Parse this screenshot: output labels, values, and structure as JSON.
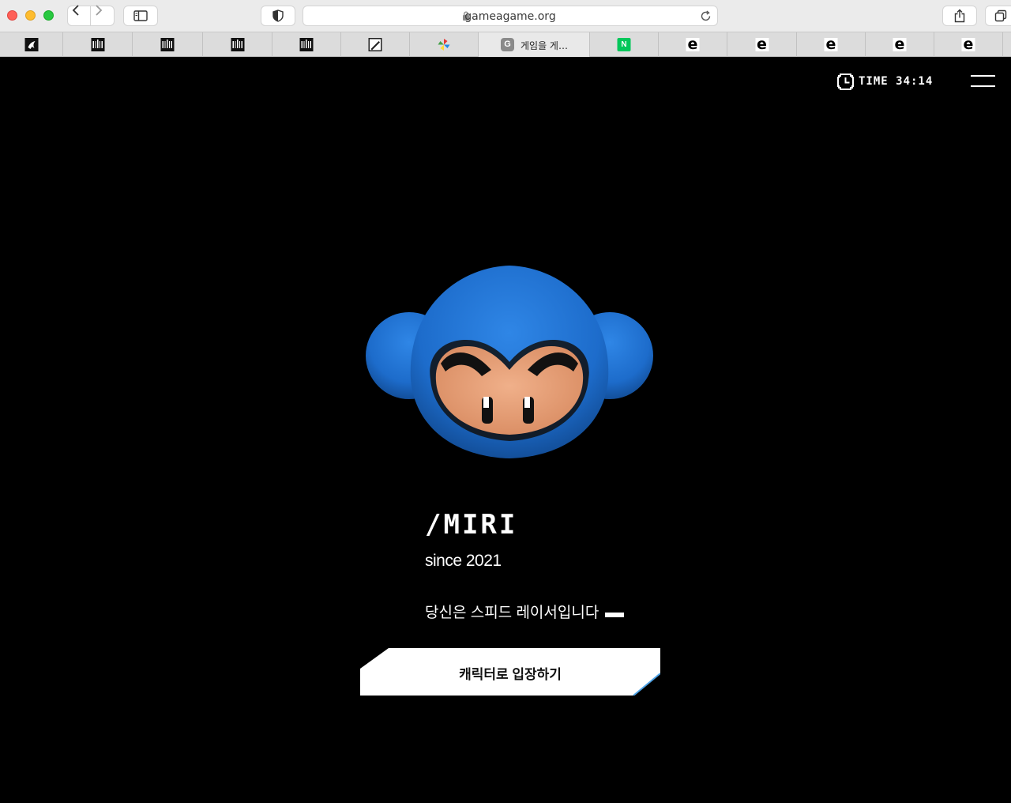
{
  "browser": {
    "url": "gameagame.org",
    "tabs": [
      {
        "icon": "dark-bird-favicon",
        "title": ""
      },
      {
        "icon": "barcode-favicon",
        "title": ""
      },
      {
        "icon": "barcode-favicon",
        "title": ""
      },
      {
        "icon": "barcode-favicon",
        "title": ""
      },
      {
        "icon": "barcode-favicon",
        "title": ""
      },
      {
        "icon": "pen-favicon",
        "title": ""
      },
      {
        "icon": "pinwheel-favicon",
        "title": ""
      },
      {
        "icon": "g-favicon",
        "title": "게임을 게…",
        "badge": "G"
      },
      {
        "icon": "naver-favicon",
        "title": "",
        "badge": "N"
      },
      {
        "icon": "e-favicon",
        "title": "",
        "badge": "e"
      },
      {
        "icon": "e-favicon",
        "title": "",
        "badge": "e"
      },
      {
        "icon": "e-favicon",
        "title": "",
        "badge": "e"
      },
      {
        "icon": "e-favicon",
        "title": "",
        "badge": "e"
      },
      {
        "icon": "e-favicon",
        "title": "",
        "badge": "e"
      }
    ]
  },
  "header": {
    "timer_text": "TIME 34:14"
  },
  "character": {
    "name": "/MIRI",
    "since": "since 2021",
    "description": "당신은 스피드 레이서입니다",
    "enter_label": "캐릭터로 입장하기"
  },
  "colors": {
    "page_bg": "#000000",
    "helmet_blue": "#1f6fcf",
    "face_skin": "#e9a57e",
    "button_bg": "#ffffff",
    "button_accent": "#4fa3e6"
  }
}
